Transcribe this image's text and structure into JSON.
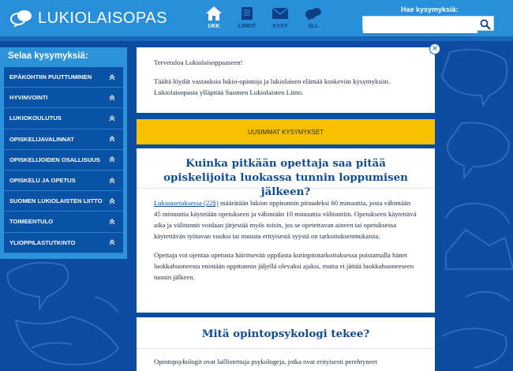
{
  "header": {
    "logo_text": "LUKIOLAISOPAS",
    "nav": [
      {
        "label": "UKK",
        "icon": "home-icon",
        "active": true
      },
      {
        "label": "LINKIT",
        "icon": "book-icon",
        "active": false
      },
      {
        "label": "KYSY",
        "icon": "envelope-icon",
        "active": false
      },
      {
        "label": "SLL",
        "icon": "sll-logo-icon",
        "active": false
      }
    ],
    "search_label": "Hae kysymyksiä:",
    "search_value": ""
  },
  "sidebar": {
    "title": "Selaa kysymyksiä:",
    "items": [
      {
        "label": "EPÄKOHTIIN PUUTTUMINEN"
      },
      {
        "label": "HYVINVOINTI"
      },
      {
        "label": "LUKIOKOULUTUS"
      },
      {
        "label": "OPISKELIJAVALINNAT"
      },
      {
        "label": "OPISKELIJOIDEN OSALLISUUS"
      },
      {
        "label": "OPISKELU JA OPETUS"
      },
      {
        "label": "SUOMEN LUKIOLAISTEN LIITTO"
      },
      {
        "label": "TOIMEENTULO"
      },
      {
        "label": "YLIOPPILASTUTKINTO"
      }
    ]
  },
  "welcome": {
    "greeting": "Tervetuloa Lukiolaisoppaaseen!",
    "text": "Täältä löydät vastauksia lukio-opintoja ja lukiolaisen elämää koskeviin kysymyksiin. Lukiolaisopasta ylläpitää Suomen Lukiolaisten Liitto.",
    "close": "×"
  },
  "latest_button": "UUSIMMAT KYSYMYKSET",
  "questions": [
    {
      "title": "Kuinka pitkään opettaja saa pitää opiskelijoita luokassa tunnin loppumisen jälkeen?",
      "link_text": "Lukioasetuksessa (22§)",
      "p1_rest": " määrätään lukion oppitunnin pituudeksi 60 minuuttia, josta vähintään 45 minuuttia käytetään opetukseen ja vähintään 10 minuuttia välituntiin. Opetukseen käytettävä aika ja välitunnit voidaan järjestää myös toisin, jos se opetettavan aineen tai opetuksessa käytettävän työtavan vuoksi tai muusta erityisestä syystä on tarkoituksenmukaista.",
      "p2": "Opettaja voi ojentaa opetusta häiritsevää oppilasta kurinpitotarkoituksessa poistamalla hänet luokkahuoneesta enintään oppitunnin jäljellä olevaksi ajaksi, mutta ei jättää luokkahuoneeseen tunnin jälkeen."
    },
    {
      "title": "Mitä opintopsykologi tekee?",
      "p1": "Opintopsykologit ovat laillistettuja psykologeja, jotka ovat erityisesti perehtyneet"
    }
  ],
  "colors": {
    "header": "#2a8fd9",
    "background": "#0c4da2",
    "sidebar": "#2d93d8",
    "sidebar_item": "#0a52a6",
    "accent_yellow": "#f7c100",
    "title_blue": "#114d95"
  }
}
